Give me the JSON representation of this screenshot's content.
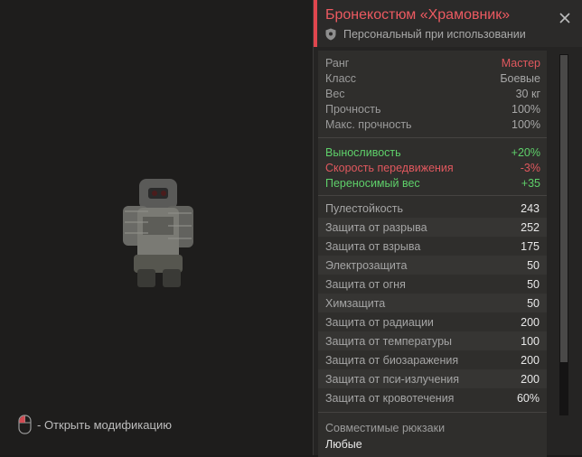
{
  "item": {
    "title": "Бронекостюм «Храмовник»",
    "binding": "Персональный при использовании"
  },
  "mod_hint": "- Открыть модификацию",
  "info": [
    {
      "label": "Ранг",
      "value": "Мастер"
    },
    {
      "label": "Класс",
      "value": "Боевые"
    },
    {
      "label": "Вес",
      "value": "30 кг"
    },
    {
      "label": "Прочность",
      "value": "100%"
    },
    {
      "label": "Макс. прочность",
      "value": "100%"
    }
  ],
  "effects": [
    {
      "label": "Выносливость",
      "value": "+20%"
    },
    {
      "label": "Скорость передвижения",
      "value": "-3%"
    },
    {
      "label": "Переносимый вес",
      "value": "+35"
    }
  ],
  "protections": [
    {
      "label": "Пулестойкость",
      "value": "243"
    },
    {
      "label": "Защита от разрыва",
      "value": "252"
    },
    {
      "label": "Защита от взрыва",
      "value": "175"
    },
    {
      "label": "Электрозащита",
      "value": "50"
    },
    {
      "label": "Защита от огня",
      "value": "50"
    },
    {
      "label": "Химзащита",
      "value": "50"
    },
    {
      "label": "Защита от радиации",
      "value": "200"
    },
    {
      "label": "Защита от температуры",
      "value": "100"
    },
    {
      "label": "Защита от биозаражения",
      "value": "200"
    },
    {
      "label": "Защита от пси-излучения",
      "value": "200"
    },
    {
      "label": "Защита от кровотечения",
      "value": "60%"
    }
  ],
  "compat": {
    "title": "Совместимые рюкзаки",
    "value": "Любые"
  },
  "icons": {
    "close": "close-icon",
    "shield": "shield-icon",
    "mouse": "mouse-icon"
  },
  "colors": {
    "accent": "#e0464e",
    "rank_value": "#e0585e",
    "positive": "#5ed06a",
    "negative": "#e0585e"
  }
}
